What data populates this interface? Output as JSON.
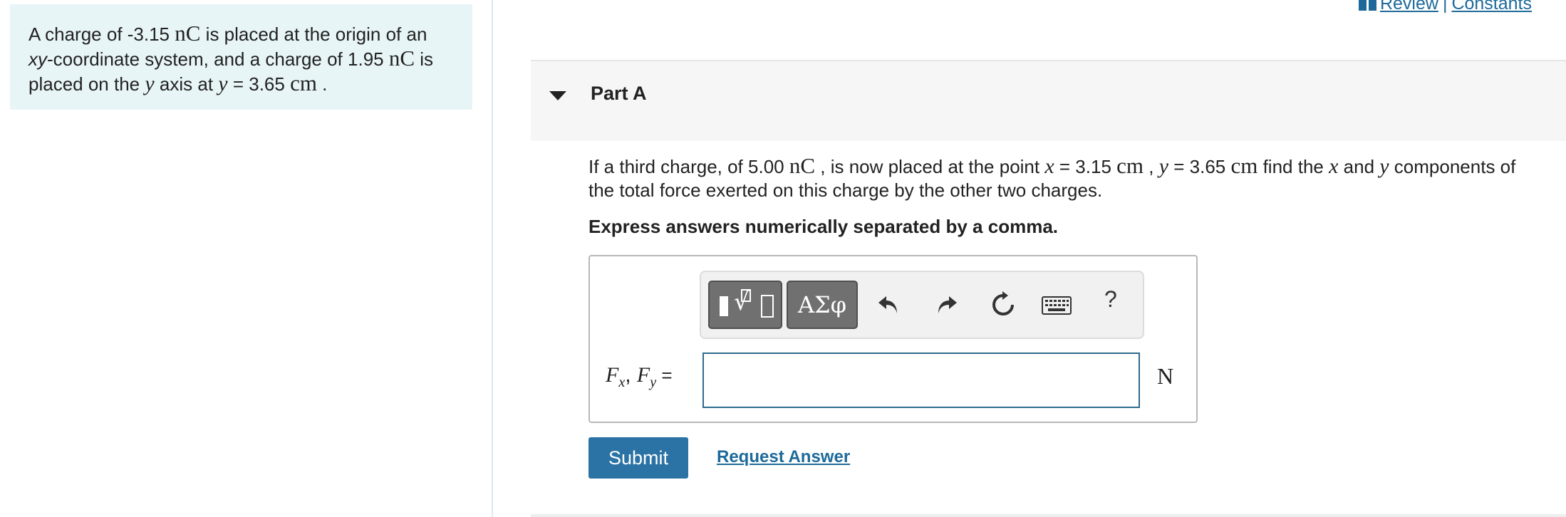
{
  "intro": {
    "line1_a": "A charge of -3.15 ",
    "line1_unit": "nC",
    "line1_b": " is placed at the origin of an",
    "line2_a": "xy",
    "line2_b": "-coordinate system, and a charge of 1.95 ",
    "line2_unit": "nC",
    "line2_c": " is",
    "line3_a": "placed on the ",
    "line3_var": "y",
    "line3_b": " axis at ",
    "line3_var2": "y",
    "line3_c": " = 3.65 ",
    "line3_unit": "cm",
    "line3_d": " ."
  },
  "links": {
    "review": "Review",
    "separator": "|",
    "constants": "Constants"
  },
  "part": {
    "title": "Part A"
  },
  "question": {
    "a": "If a third charge, of 5.00 ",
    "unit1": "nC",
    "b": " , is now placed at the point ",
    "var_x": "x",
    "c": " = 3.15 ",
    "unit2": "cm",
    "d": " , ",
    "var_y": "y",
    "e": " = 3.65 ",
    "unit3": "cm",
    "f": " find the ",
    "var_x2": "x",
    "g": " and ",
    "var_y2": "y",
    "h": " components of",
    "line2": "the total force exerted on this charge by the other two charges."
  },
  "instruction": "Express answers numerically separated by a comma.",
  "toolbar": {
    "greek_label": "ΑΣφ",
    "help_label": "?"
  },
  "answer": {
    "label_f1": "F",
    "label_sub1": "x",
    "label_comma": ", ",
    "label_f2": "F",
    "label_sub2": "y",
    "label_eq": " =",
    "value": "",
    "unit": "N"
  },
  "actions": {
    "submit": "Submit",
    "request_answer": "Request Answer"
  },
  "colors": {
    "intro_bg": "#e8f5f7",
    "link": "#1d6a9a",
    "submit_bg": "#2b73a5",
    "input_border": "#2d6b8e"
  }
}
